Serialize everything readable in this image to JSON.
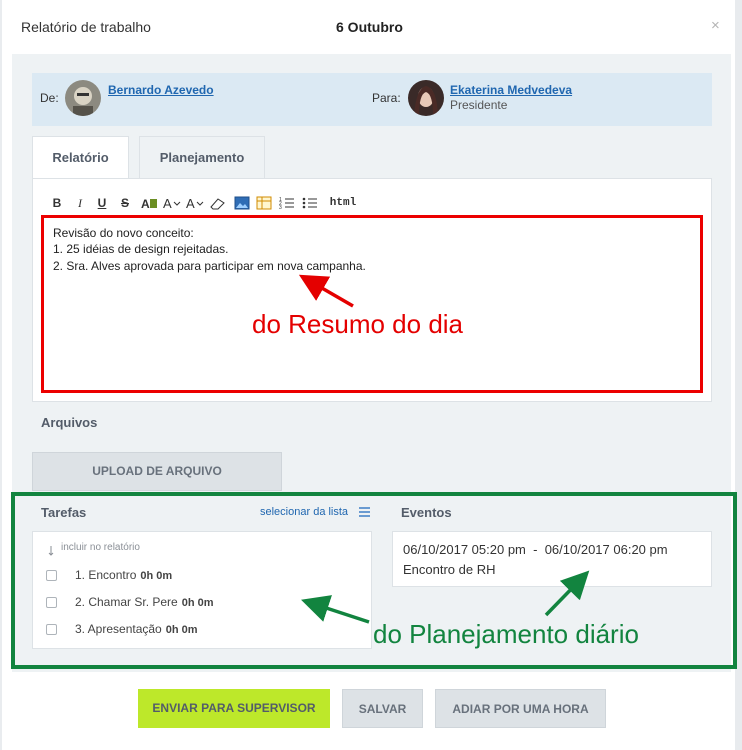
{
  "header": {
    "title": "Relatório de trabalho",
    "date": "6 Outubro",
    "close_icon": "×"
  },
  "from": {
    "label": "De:",
    "name": "Bernardo Azevedo"
  },
  "to": {
    "label": "Para:",
    "name": "Ekaterina Medvedeva",
    "role": "Presidente"
  },
  "tabs": [
    {
      "label": "Relatório",
      "active": true
    },
    {
      "label": "Planejamento",
      "active": false
    }
  ],
  "toolbar": {
    "bold": "B",
    "italic": "I",
    "underline": "U",
    "strike": "S",
    "html": "html"
  },
  "editor": {
    "lines": [
      "Revisão do novo conceito:",
      "1. 25 idéias de design rejeitadas.",
      "2. Sra. Alves aprovada para participar em nova campanha."
    ]
  },
  "annotations": {
    "summary": "do Resumo do dia",
    "planning": "do Planejamento diário"
  },
  "files": {
    "title": "Arquivos",
    "upload_label": "UPLOAD DE ARQUIVO"
  },
  "tasks": {
    "title": "Tarefas",
    "select_link": "selecionar da lista",
    "include_label": "incluir no relatório",
    "items": [
      {
        "name": "1. Encontro",
        "duration": "0h 0m",
        "checked": false
      },
      {
        "name": "2. Chamar Sr. Pere",
        "duration": "0h 0m",
        "checked": false
      },
      {
        "name": "3. Apresentação",
        "duration": "0h 0m",
        "checked": false
      }
    ]
  },
  "events": {
    "title": "Eventos",
    "start": "06/10/2017 05:20 pm",
    "separator": "-",
    "end": "06/10/2017 06:20 pm",
    "name": "Encontro de RH"
  },
  "buttons": {
    "send": "ENVIAR PARA SUPERVISOR",
    "save": "SALVAR",
    "defer": "ADIAR POR UMA HORA"
  },
  "colors": {
    "accent_send": "#bde82a",
    "link": "#2067b0",
    "annotation_red": "#e40000",
    "annotation_green": "#12843f"
  }
}
